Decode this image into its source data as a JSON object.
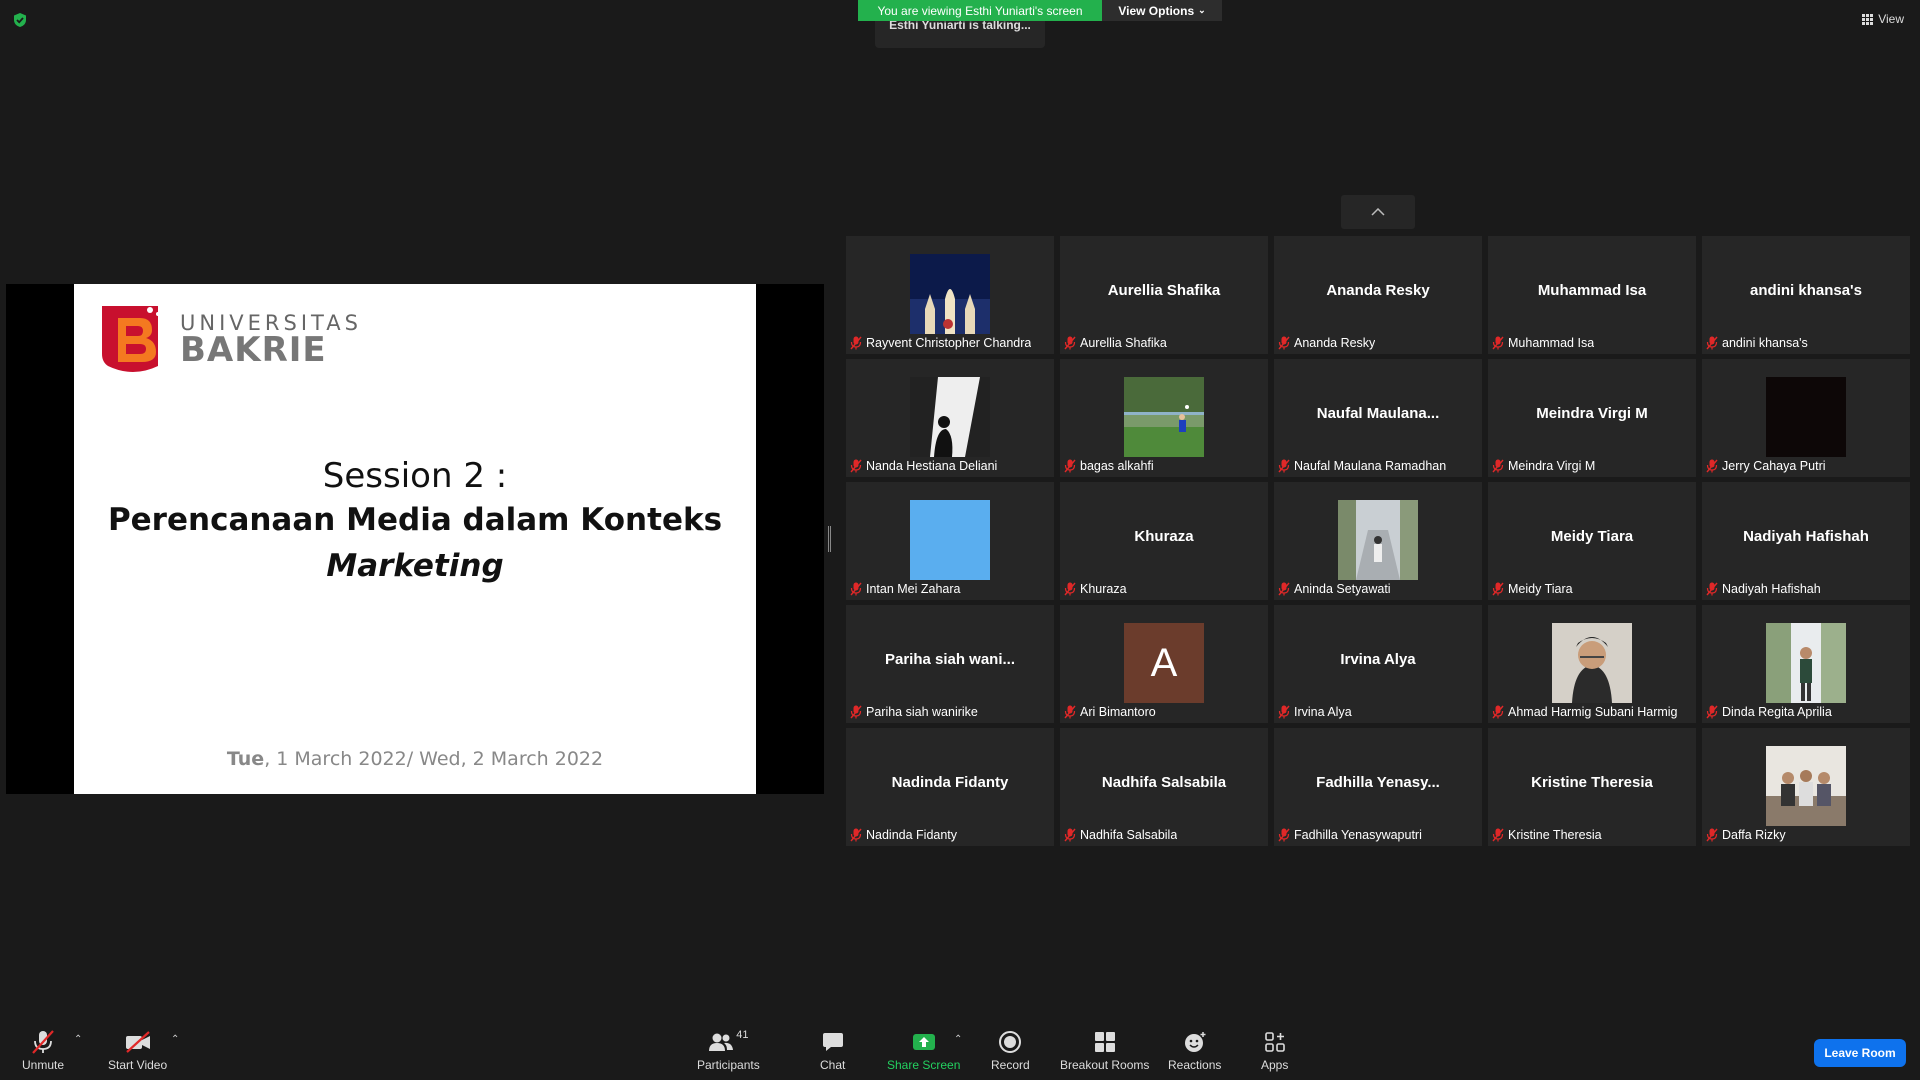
{
  "top": {
    "viewing_banner": "You are viewing Esthi Yuniarti's screen",
    "view_options": "View Options",
    "talking": "Esthi Yuniarti is talking...",
    "view_label": "View"
  },
  "slide": {
    "logo_top": "UNIVERSITAS",
    "logo_bottom": "BAKRIE",
    "session": "Session 2 :",
    "title": "Perencanaan Media dalam Konteks",
    "subtitle": "Marketing",
    "date_bold": "Tue",
    "date_rest": ", 1 March 2022/ Wed, 2 March 2022"
  },
  "participants": [
    {
      "big": "",
      "label": "Rayvent Christopher Chandra",
      "photo": "night-building"
    },
    {
      "big": "Aurellia Shafika",
      "label": "Aurellia Shafika"
    },
    {
      "big": "Ananda Resky",
      "label": "Ananda Resky"
    },
    {
      "big": "Muhammad Isa",
      "label": "Muhammad Isa"
    },
    {
      "big": "andini khansa's",
      "label": "andini khansa's"
    },
    {
      "big": "",
      "label": "Nanda Hestiana Deliani",
      "photo": "window-silhouette"
    },
    {
      "big": "",
      "label": "bagas alkahfi",
      "photo": "football-field"
    },
    {
      "big": "Naufal  Maulana...",
      "label": "Naufal Maulana Ramadhan"
    },
    {
      "big": "Meindra Virgi M",
      "label": "Meindra Virgi M"
    },
    {
      "big": "",
      "label": "Jerry Cahaya Putri",
      "photo": "dark-square"
    },
    {
      "big": "",
      "label": "Intan Mei Zahara",
      "photo": "blue-square"
    },
    {
      "big": "Khuraza",
      "label": "Khuraza"
    },
    {
      "big": "",
      "label": "Aninda Setyawati",
      "photo": "stairs-person"
    },
    {
      "big": "Meidy Tiara",
      "label": "Meidy Tiara"
    },
    {
      "big": "Nadiyah Hafishah",
      "label": "Nadiyah Hafishah"
    },
    {
      "big": "Pariha  siah  wani...",
      "label": "Pariha siah wanirike"
    },
    {
      "big": "",
      "label": "Ari Bimantoro",
      "photo": "avatar-letter",
      "letter": "A"
    },
    {
      "big": "Irvina Alya",
      "label": "Irvina Alya"
    },
    {
      "big": "",
      "label": "Ahmad Harmig Subani Harmig",
      "photo": "selfie"
    },
    {
      "big": "",
      "label": "Dinda Regita Aprilia",
      "photo": "outdoor-person"
    },
    {
      "big": "Nadinda Fidanty",
      "label": "Nadinda Fidanty"
    },
    {
      "big": "Nadhifa Salsabila",
      "label": "Nadhifa Salsabila"
    },
    {
      "big": "Fadhilla  Yenasy...",
      "label": "Fadhilla Yenasywaputri"
    },
    {
      "big": "Kristine Theresia",
      "label": "Kristine Theresia"
    },
    {
      "big": "",
      "label": "Daffa Rizky",
      "photo": "group-photo"
    }
  ],
  "toolbar": {
    "unmute": "Unmute",
    "start_video": "Start Video",
    "participants": "Participants",
    "participant_count": "41",
    "chat": "Chat",
    "share_screen": "Share Screen",
    "record": "Record",
    "breakout_rooms": "Breakout Rooms",
    "reactions": "Reactions",
    "apps": "Apps",
    "leave": "Leave Room"
  },
  "colors": {
    "share_green": "#23b14d",
    "leave_blue": "#0e72ed",
    "mute_red": "#e02828"
  }
}
